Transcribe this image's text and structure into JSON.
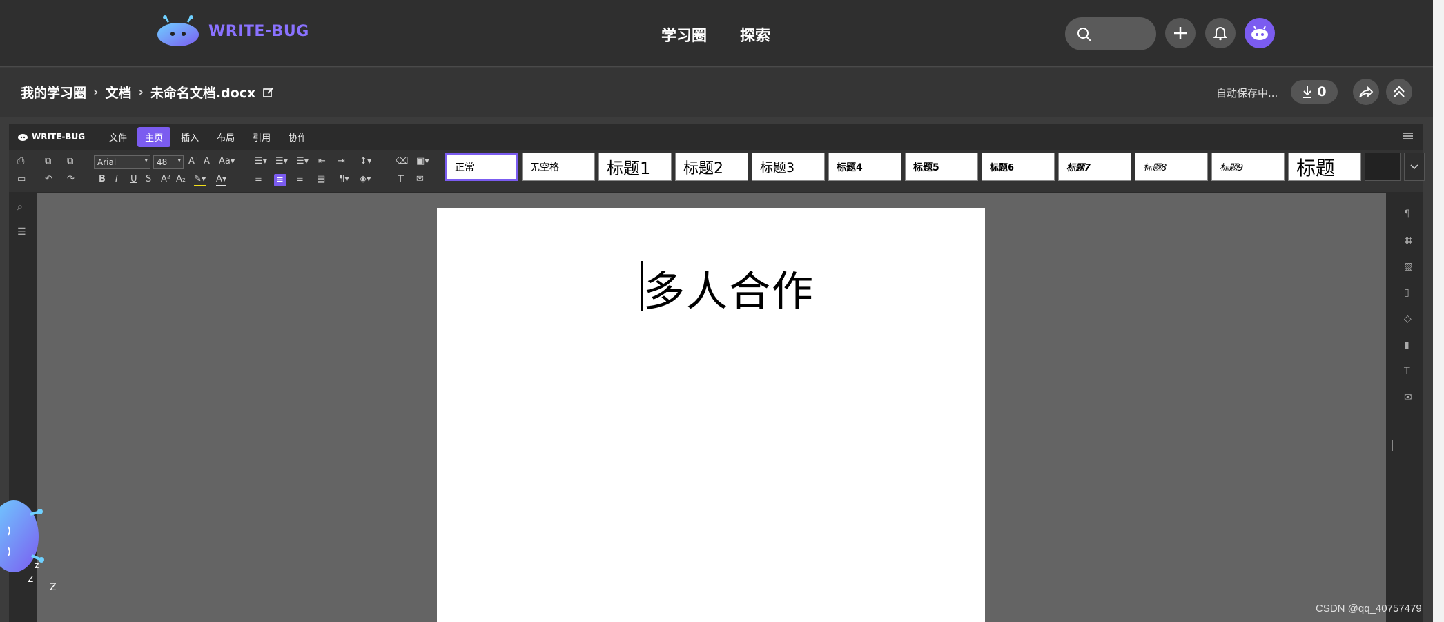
{
  "topnav": {
    "brand": "WRITE-BUG",
    "links": [
      "学习圈",
      "探索"
    ],
    "brand_color": "#8a72ff"
  },
  "breadcrumb": {
    "items": [
      "我的学习圈",
      "文档",
      "未命名文档.docx"
    ],
    "autosave": "自动保存中...",
    "download_count": "0"
  },
  "editor": {
    "brand": "WRITE-BUG",
    "menu": [
      "文件",
      "主页",
      "插入",
      "布局",
      "引用",
      "协作"
    ],
    "active_menu": "主页",
    "font": "Arial",
    "font_size": "48",
    "styles": [
      "正常",
      "无空格",
      "标题1",
      "标题2",
      "标题3",
      "标题4",
      "标题5",
      "标题6",
      "标题7",
      "标题8",
      "标题9",
      "标题"
    ],
    "accent": "#7b5cf0"
  },
  "document": {
    "title": "多人合作"
  },
  "watermark": "CSDN @qq_40757479"
}
